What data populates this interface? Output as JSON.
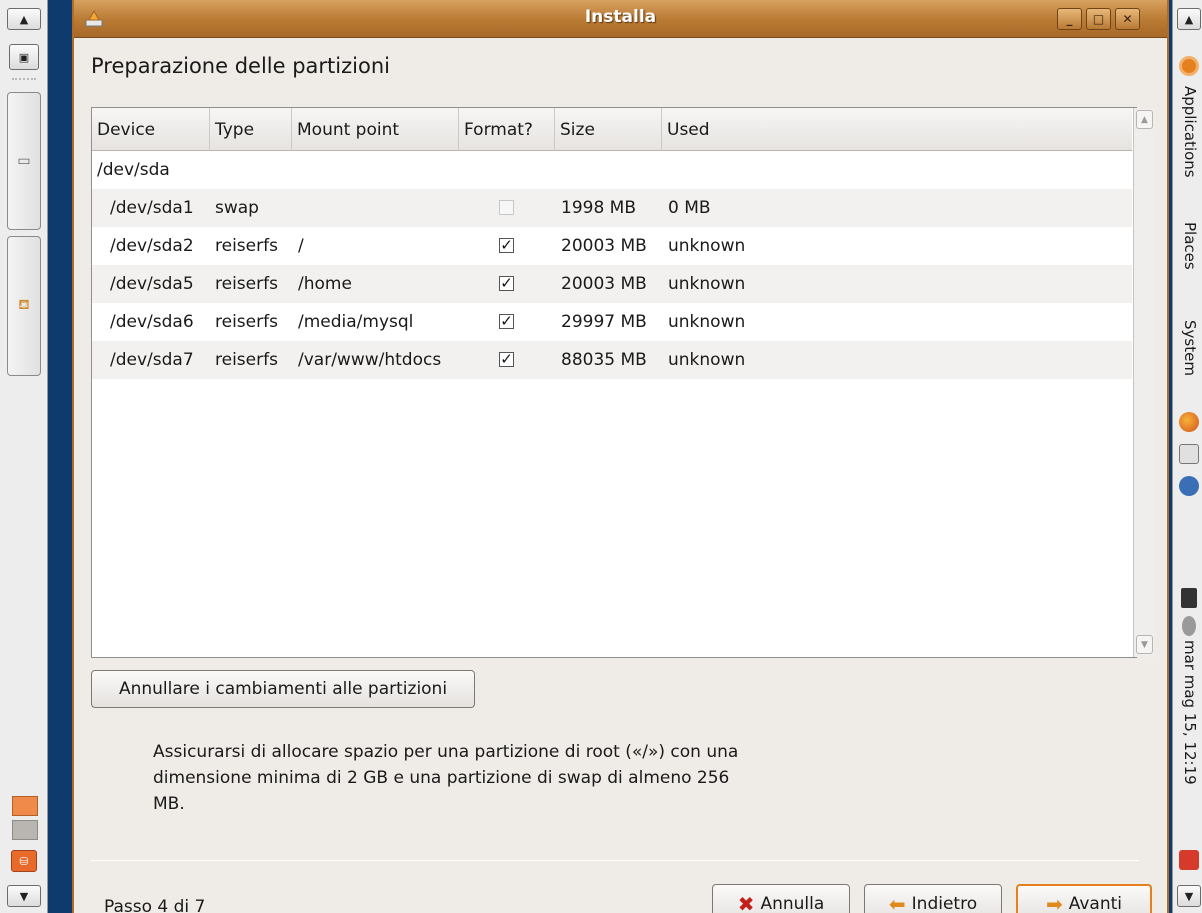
{
  "window": {
    "title": "Installa"
  },
  "page": {
    "title": "Preparazione delle partizioni"
  },
  "table": {
    "columns": [
      "Device",
      "Type",
      "Mount point",
      "Format?",
      "Size",
      "Used"
    ],
    "disk": "/dev/sda",
    "rows": [
      {
        "device": "/dev/sda1",
        "type": "swap",
        "mount": "",
        "format": false,
        "format_enabled": false,
        "size": "1998 MB",
        "used": "0 MB"
      },
      {
        "device": "/dev/sda2",
        "type": "reiserfs",
        "mount": "/",
        "format": true,
        "format_enabled": true,
        "size": "20003 MB",
        "used": "unknown"
      },
      {
        "device": "/dev/sda5",
        "type": "reiserfs",
        "mount": "/home",
        "format": true,
        "format_enabled": true,
        "size": "20003 MB",
        "used": "unknown"
      },
      {
        "device": "/dev/sda6",
        "type": "reiserfs",
        "mount": "/media/mysql",
        "format": true,
        "format_enabled": true,
        "size": "29997 MB",
        "used": "unknown"
      },
      {
        "device": "/dev/sda7",
        "type": "reiserfs",
        "mount": "/var/www/htdocs",
        "format": true,
        "format_enabled": true,
        "size": "88035 MB",
        "used": "unknown"
      }
    ]
  },
  "undo_button": "Annullare i cambiamenti alle partizioni",
  "hint": "Assicurarsi di allocare spazio per una partizione di root («/») con una dimensione minima di 2 GB e una partizione di swap di almeno 256 MB.",
  "footer": {
    "step": "Passo 4 di 7",
    "cancel": "Annulla",
    "back": "Indietro",
    "next": "Avanti"
  },
  "right_panel": {
    "menus": [
      "Applications",
      "Places",
      "System"
    ],
    "clock": "mar mag 15, 12:19"
  },
  "icons": [
    "app-installer-icon",
    "minimize-icon",
    "maximize-icon",
    "close-icon",
    "cancel-icon",
    "back-arrow-icon",
    "forward-arrow-icon",
    "ubuntu-logo-icon",
    "firefox-icon",
    "mail-icon",
    "help-icon",
    "network-icon",
    "volume-icon",
    "logout-icon"
  ],
  "colors": {
    "titlebar": "#b97a33",
    "desktop": "#0f3a6e",
    "window_bg": "#efebe7",
    "accent": "#e5801f"
  }
}
